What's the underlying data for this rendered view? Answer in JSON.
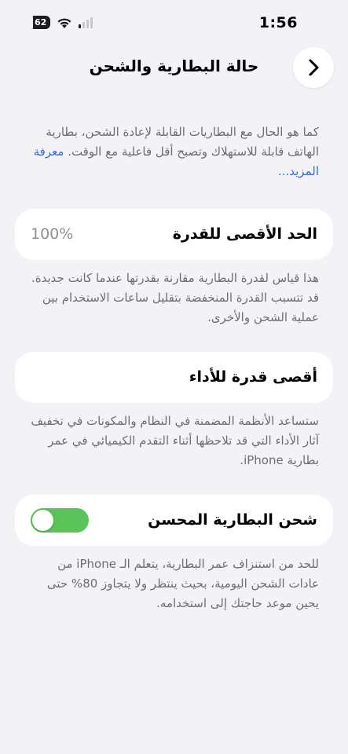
{
  "status_bar": {
    "time": "1:56",
    "battery_level": "62",
    "signal_bars_active": 1,
    "signal_bars_total": 4
  },
  "nav": {
    "title": "حالة البطارية والشحن",
    "back_icon": "chevron-icon"
  },
  "intro": {
    "text": "كما هو الحال مع البطاريات القابلة لإعادة الشحن، بطارية الهاتف قابلة للاستهلاك وتصبح أقل فاعلية مع الوقت.",
    "link": "معرفة المزيد..."
  },
  "maximum_capacity": {
    "label": "الحد الأقصى للقدرة",
    "value": "100%",
    "footer": "هذا قياس لقدرة البطارية مقارنة بقدرتها عندما كانت جديدة. قد تتسبب القدرة المنخفضة بتقليل ساعات الاستخدام بين عملية الشحن والأخرى."
  },
  "peak_performance": {
    "label": "أقصى قدرة للأداء",
    "footer": "ستساعد الأنظمة المضمنة في النظام والمكونات في تخفيف آثار الأداء التي قد تلاحظها أثناء التقدم الكيميائي في عمر بطارية iPhone."
  },
  "optimized_charging": {
    "label": "شحن البطارية المحسن",
    "enabled": true,
    "toggle_color": "#5ac45a",
    "footer": "للحد من استنزاف عمر البطارية، يتعلم الـ iPhone من عادات الشحن اليومية، بحيث ينتظر ولا يتجاوز 80% حتى يحين موعد حاجتك إلى استخدامه."
  },
  "colors": {
    "background": "#f2f2f7",
    "link": "#2f6fde",
    "secondary_text": "#6d6d72"
  }
}
